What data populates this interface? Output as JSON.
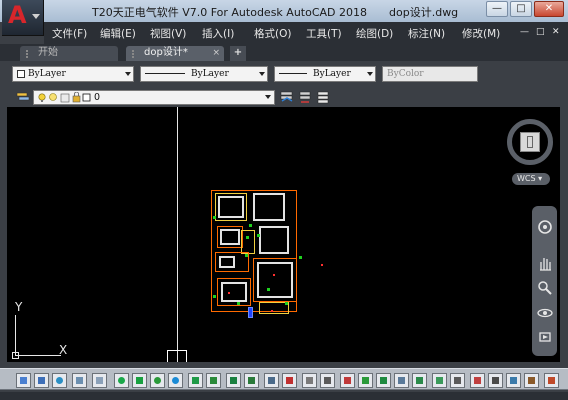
{
  "window": {
    "app_title": "T20天正电气软件 V7.0 For Autodesk AutoCAD 2018",
    "document": "dop设计.dwg",
    "controls": {
      "minimize": "—",
      "maximize": "□",
      "close": "✕"
    }
  },
  "app_logo": {
    "letter": "A"
  },
  "menu": [
    "文件(F)",
    "编辑(E)",
    "视图(V)",
    "插入(I)",
    "格式(O)",
    "工具(T)",
    "绘图(D)",
    "标注(N)",
    "修改(M)"
  ],
  "menu_window_controls": [
    "—",
    "□",
    "✕"
  ],
  "tabs": {
    "start": "开始",
    "active": "dop设计*",
    "close_symbol": "×",
    "add": "+"
  },
  "properties": {
    "color": "ByLayer",
    "linetype": "ByLayer",
    "lineweight": "ByLayer",
    "plotstyle": "ByColor"
  },
  "layer": {
    "current": "0"
  },
  "viewcube": {
    "face": "上",
    "coords": "WCS"
  },
  "ucs": {
    "x": "X",
    "y": "Y"
  },
  "colors": {
    "canvas": "#000000",
    "chrome": "#3b3f45",
    "autocad_red": "#d8262b",
    "wall_orange": "#ff6a00",
    "marker_green": "#1fd11f"
  },
  "icons": {
    "navbar": [
      "steering-wheel-icon",
      "pan-icon",
      "zoom-icon",
      "orbit-icon",
      "showmotion-icon"
    ],
    "bottom_toolbar_count": 32
  }
}
